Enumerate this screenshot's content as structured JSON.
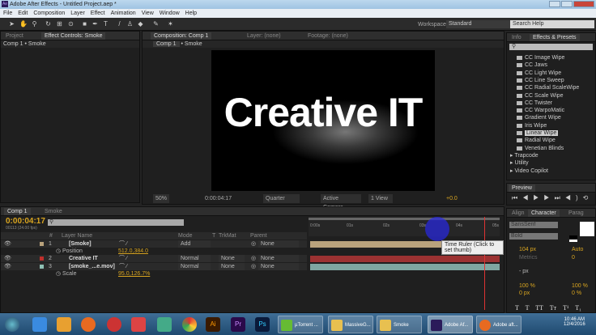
{
  "window": {
    "title": "Adobe After Effects - Untitled Project.aep *",
    "logo": "Ae"
  },
  "menu": [
    "File",
    "Edit",
    "Composition",
    "Layer",
    "Effect",
    "Animation",
    "View",
    "Window",
    "Help"
  ],
  "toolbar": {
    "workspace_label": "Workspace:",
    "workspace_value": "Standard",
    "search_placeholder": "Search Help"
  },
  "left_panel": {
    "tabs": [
      "Project",
      "Effect Controls: Smoke"
    ],
    "breadcrumb": "Comp 1 • Smoke"
  },
  "comp_panel": {
    "tabs": [
      "Composition: Comp 1",
      "Layer: (none)",
      "Footage: (none)"
    ],
    "subtabs": [
      "Comp 1",
      "Smoke"
    ],
    "preview_text": "Creative IT",
    "viewer_bar": {
      "zoom": "50%",
      "timecode": "0:00:04:17",
      "resolution": "Quarter",
      "camera": "Active Camera",
      "views": "1 View",
      "exposure": "+0.0"
    }
  },
  "effects_panel": {
    "tabs": [
      "Info",
      "Effects & Presets"
    ],
    "search": "",
    "items": [
      "CC Image Wipe",
      "CC Jaws",
      "CC Light Wipe",
      "CC Line Sweep",
      "CC Radial ScaleWipe",
      "CC Scale Wipe",
      "CC Twister",
      "CC WarpoMatic",
      "Gradient Wipe",
      "Iris Wipe",
      "Linear Wipe",
      "Radial Wipe",
      "Venetian Blinds"
    ],
    "selected": "Linear Wipe",
    "folders": [
      "Trapcode",
      "Utility",
      "Video Copilot"
    ]
  },
  "preview_panel": {
    "tab": "Preview"
  },
  "character_panel": {
    "tabs": [
      "Align",
      "Character",
      "Parag"
    ],
    "font": "SansSerif",
    "style": "Bold",
    "size": "104 px",
    "leading": "Auto",
    "kerning": "Metrics",
    "tracking": "0",
    "stroke": "- px",
    "vscale": "100 %",
    "hscale": "100 %",
    "baseline": "0 px",
    "tsume": "0 %",
    "styles": [
      "T",
      "T",
      "TT",
      "Tт",
      "T¹",
      "T₁"
    ]
  },
  "timeline": {
    "tabs": [
      "Comp 1",
      "Smoke"
    ],
    "timecode": "0:00:04:17",
    "fps": "00113 (24.00 fps)",
    "columns": [
      "#",
      "Layer Name",
      "Mode",
      "T",
      "TrkMat",
      "Parent"
    ],
    "layers": [
      {
        "num": "1",
        "name": "[Smoke]",
        "mode": "Add",
        "trkmat": "",
        "parent": "None",
        "color": "#b9a27c",
        "bar": "#b9a27c"
      },
      {
        "prop": "Position",
        "value": "512.0,384.0"
      },
      {
        "num": "2",
        "name": "Creative IT",
        "mode": "Normal",
        "trkmat": "None",
        "parent": "None",
        "color": "#c0302c",
        "bar": "#9c3232"
      },
      {
        "num": "3",
        "name": "[smoke_...e.mov]",
        "mode": "Normal",
        "trkmat": "None",
        "parent": "None",
        "color": "#8fc0b4",
        "bar": "#7fa6a1"
      },
      {
        "prop": "Scale",
        "value": "95.0,126.7%"
      }
    ],
    "ruler": [
      "0:00s",
      "01s",
      "02s",
      "03s",
      "04s",
      "05s"
    ],
    "tooltip": "Time Ruler (Click to set thumb)"
  },
  "taskbar": {
    "windows": [
      "µTorrent ...",
      "MassiveG...",
      "Smoke",
      "Adobe Af...",
      "Adobe aft..."
    ],
    "apps": [
      "Ai",
      "Pr",
      "Ps"
    ],
    "time": "10:46 AM",
    "date": "12/4/2016"
  }
}
